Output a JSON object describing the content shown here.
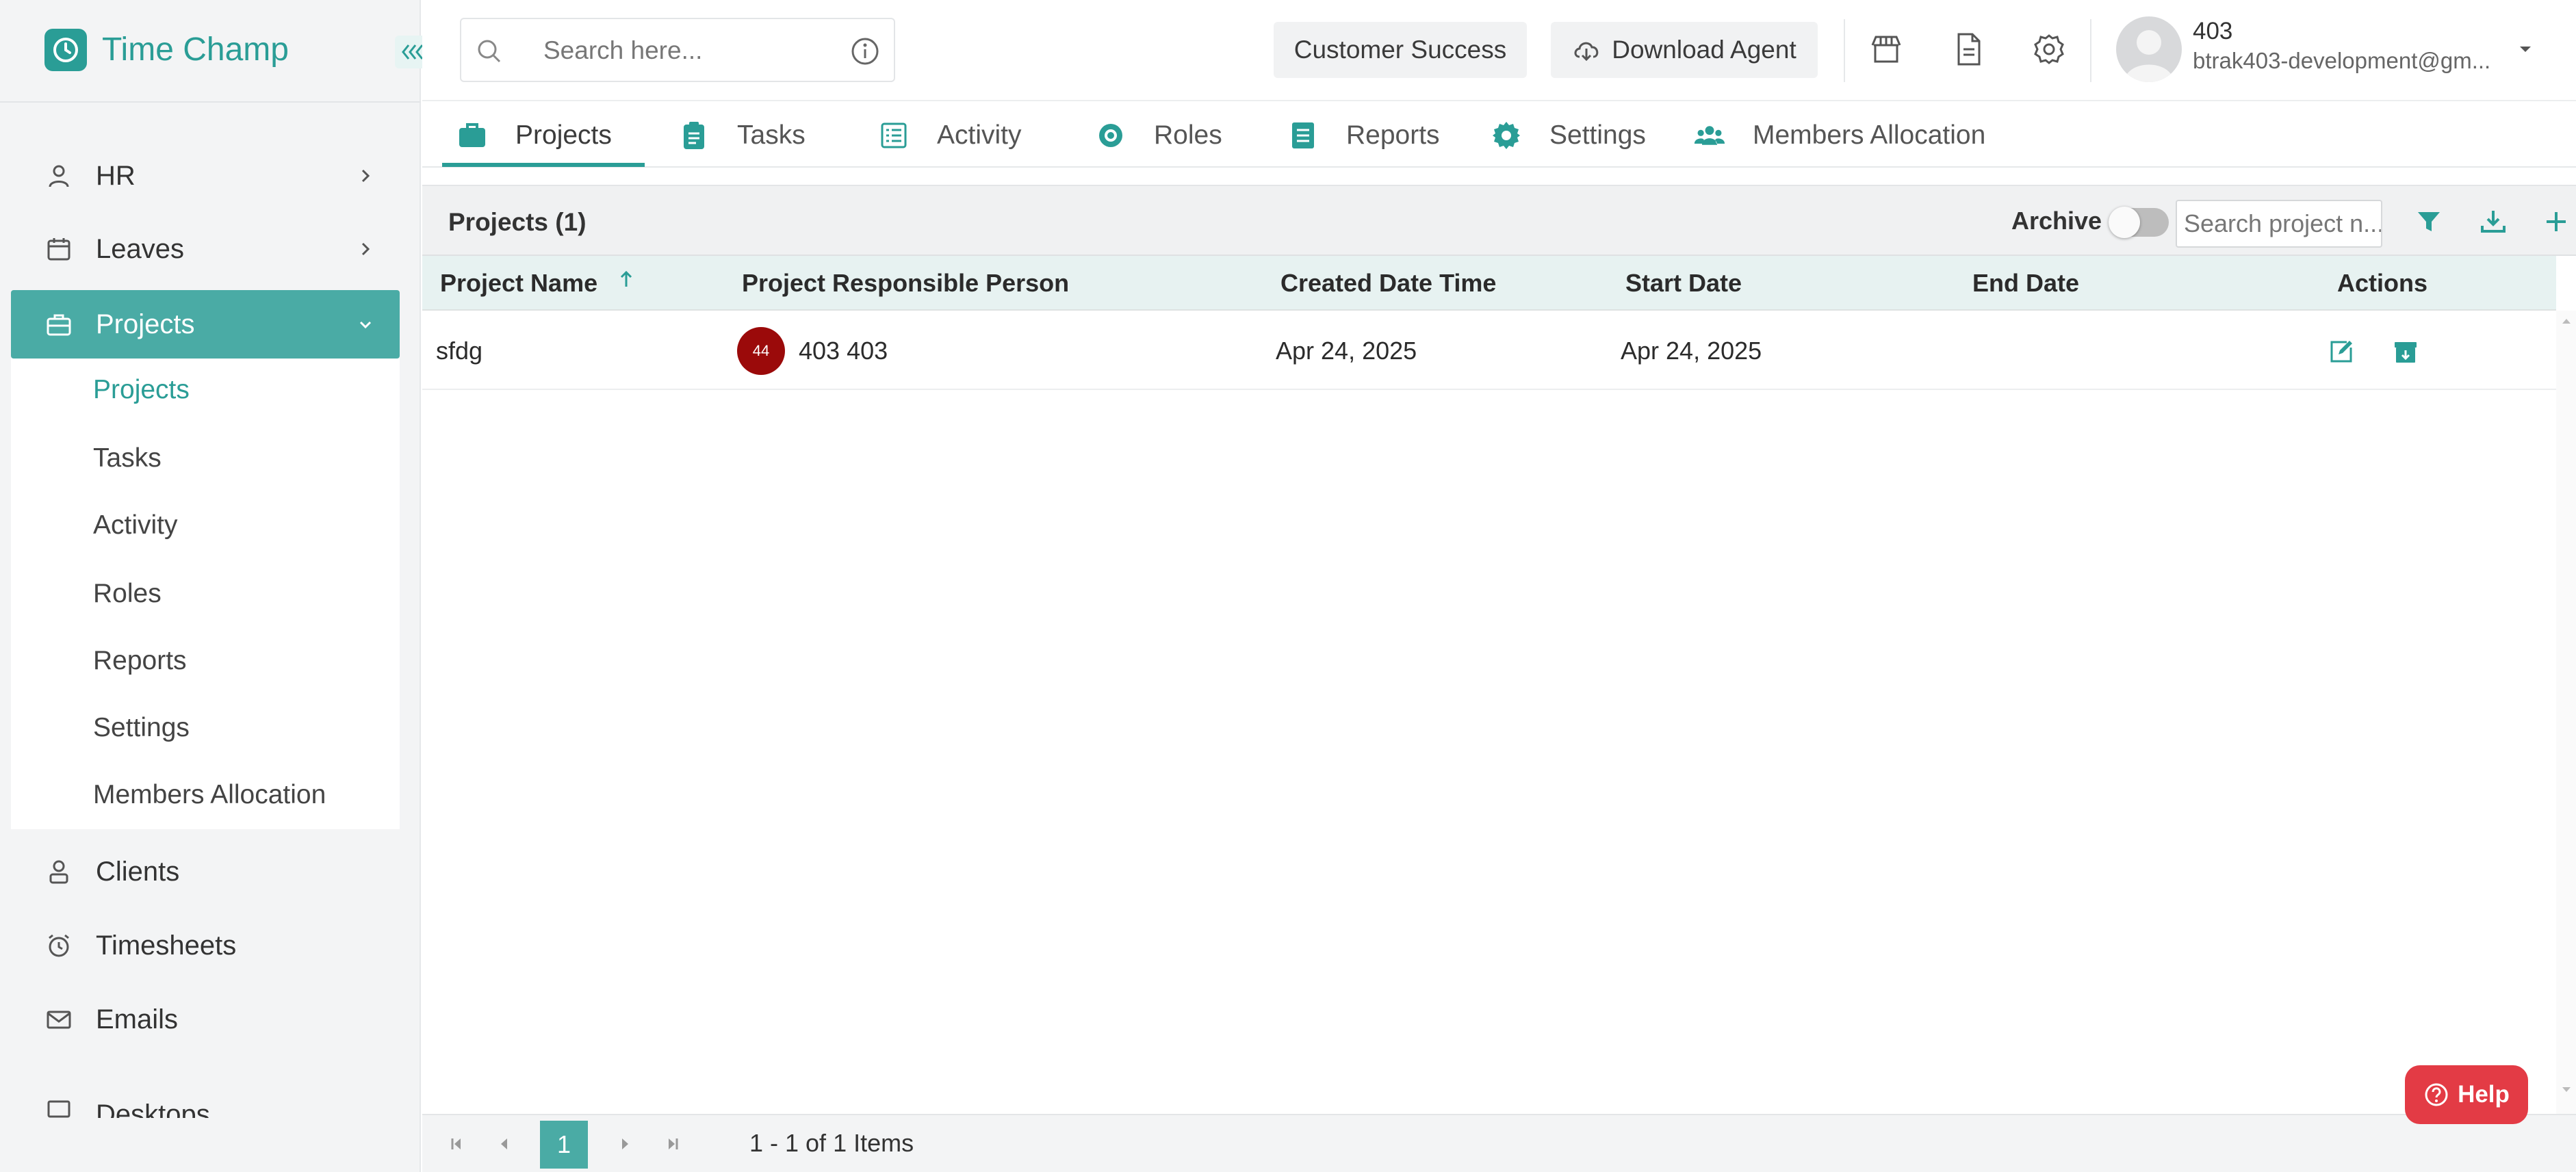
{
  "app": {
    "name": "Time Champ",
    "brand_color": "#2a9d96"
  },
  "sidebar": {
    "items": [
      {
        "label": "HR",
        "icon": "user-icon",
        "expandable": true
      },
      {
        "label": "Leaves",
        "icon": "calendar-icon",
        "expandable": true
      },
      {
        "label": "Projects",
        "icon": "briefcase-icon",
        "expandable": true,
        "active": true
      },
      {
        "label": "Clients",
        "icon": "client-icon"
      },
      {
        "label": "Timesheets",
        "icon": "alarm-clock-icon"
      },
      {
        "label": "Emails",
        "icon": "mail-icon"
      },
      {
        "label": "Desktops",
        "icon": "desktop-icon"
      }
    ],
    "projects_submenu": [
      "Projects",
      "Tasks",
      "Activity",
      "Roles",
      "Reports",
      "Settings",
      "Members Allocation"
    ]
  },
  "header": {
    "search_placeholder": "Search here...",
    "customer_success_label": "Customer Success",
    "download_agent_label": "Download Agent",
    "user": {
      "name": "403",
      "email": "btrak403-development@gm..."
    }
  },
  "tabs": [
    {
      "label": "Projects",
      "icon": "briefcase-icon",
      "active": true
    },
    {
      "label": "Tasks",
      "icon": "clipboard-icon"
    },
    {
      "label": "Activity",
      "icon": "list-icon"
    },
    {
      "label": "Roles",
      "icon": "roles-gear-icon"
    },
    {
      "label": "Reports",
      "icon": "report-icon"
    },
    {
      "label": "Settings",
      "icon": "settings-gear-icon"
    },
    {
      "label": "Members Allocation",
      "icon": "people-icon"
    }
  ],
  "grid": {
    "title": "Projects (1)",
    "archive_label": "Archive",
    "archive_on": false,
    "search_placeholder": "Search project n...",
    "columns": [
      "Project Name",
      "Project Responsible Person",
      "Created Date Time",
      "Start Date",
      "End Date",
      "Actions"
    ],
    "sort": {
      "column": "Project Name",
      "direction": "ascending"
    },
    "rows": [
      {
        "project_name": "sfdg",
        "person_initials": "44",
        "person_name": "403 403",
        "created": "Apr 24, 2025",
        "start": "Apr 24, 2025",
        "end": ""
      }
    ]
  },
  "pager": {
    "current_page": "1",
    "info": "1 - 1 of 1 Items"
  },
  "help": {
    "label": "Help",
    "color": "#e33b45"
  }
}
